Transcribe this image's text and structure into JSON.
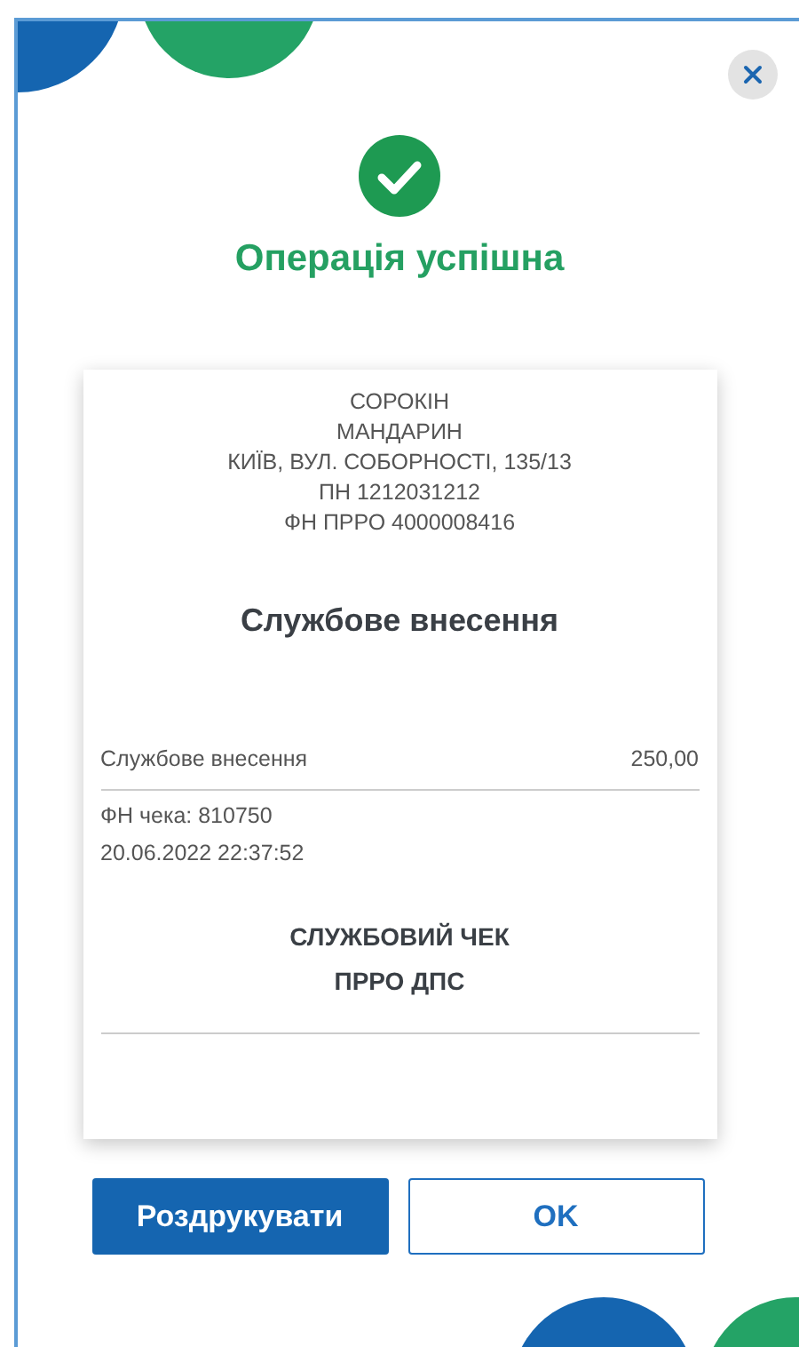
{
  "dialog": {
    "title": "Операція успішна",
    "receipt": {
      "header_lines": [
        "СОРОКІН",
        "МАНДАРИН",
        "КИЇВ, ВУЛ. СОБОРНОСТІ, 135/13",
        "ПН 1212031212",
        "ФН ПРРО 4000008416"
      ],
      "title": "Службове внесення",
      "items": [
        {
          "name": "Службове внесення",
          "amount": "250,00"
        }
      ],
      "info_lines": [
        "ФН чека: 810750",
        "20.06.2022 22:37:52"
      ],
      "footer_lines": [
        "СЛУЖБОВИЙ ЧЕК",
        "ПРРО ДПС"
      ]
    },
    "buttons": [
      {
        "label": "Роздрукувати",
        "kind": "primary"
      },
      {
        "label": "OK",
        "kind": "secondary"
      }
    ]
  }
}
